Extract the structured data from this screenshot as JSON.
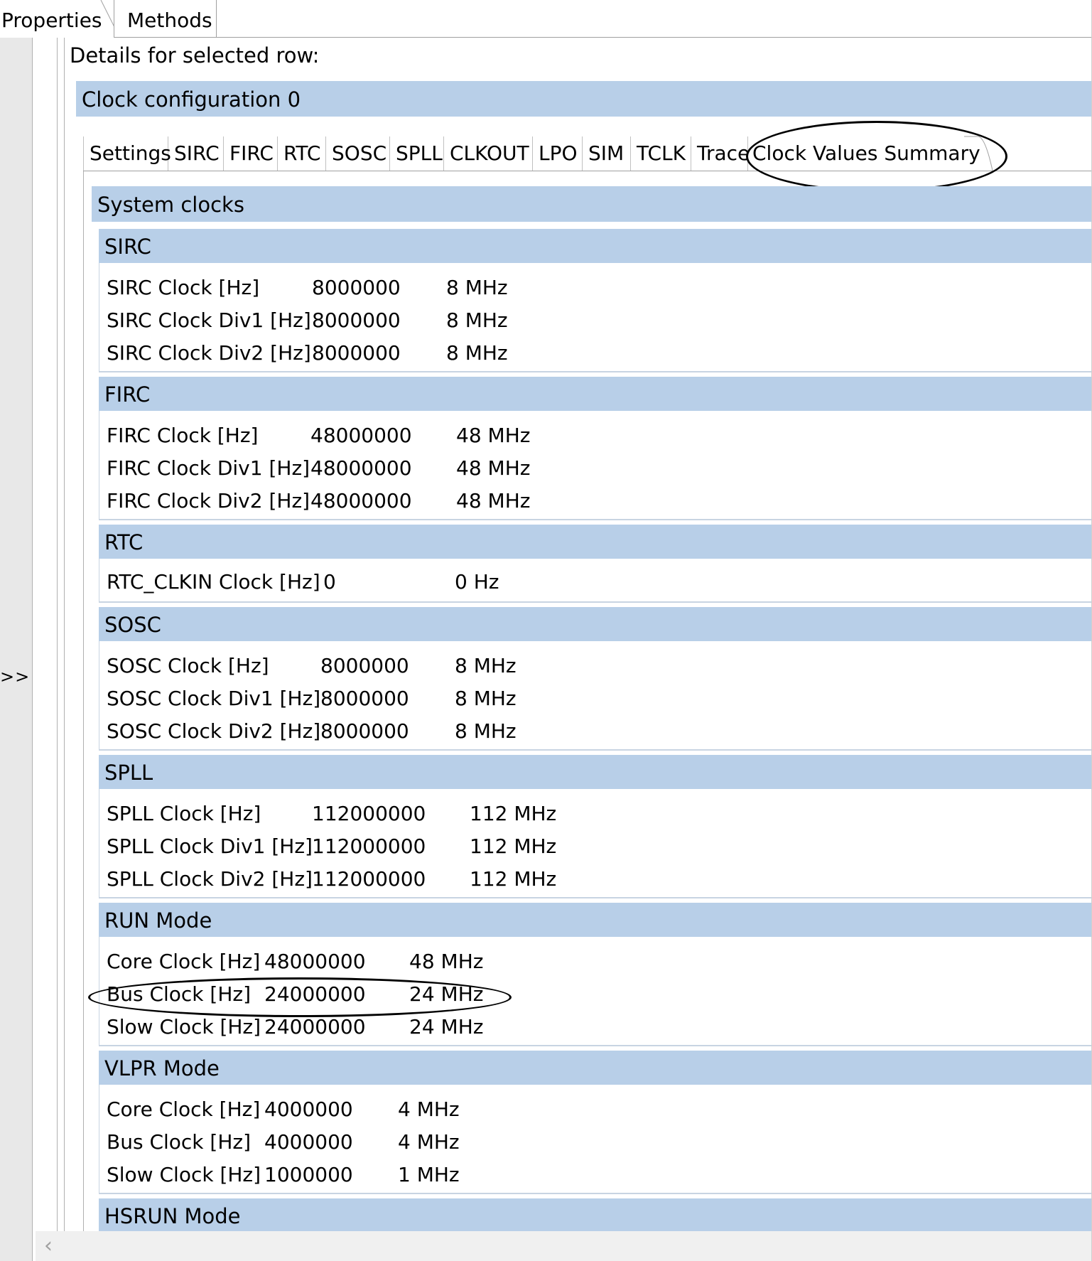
{
  "top_tabs": {
    "properties": "Properties",
    "methods": "Methods"
  },
  "gutter": {
    "expand": ">>"
  },
  "details_title": "Details for selected row:",
  "config_header": "Clock configuration 0",
  "inner_tabs": [
    "Settings",
    "SIRC",
    "FIRC",
    "RTC",
    "SOSC",
    "SPLL",
    "CLKOUT",
    "LPO",
    "SIM",
    "TCLK",
    "Trace",
    "Clock Values Summary"
  ],
  "active_tab": "Clock Values Summary",
  "system_clocks": {
    "header": "System clocks",
    "sections": [
      {
        "title": "SIRC",
        "rows": [
          [
            "SIRC Clock [Hz]",
            "8000000",
            "8 MHz"
          ],
          [
            "SIRC Clock Div1 [Hz]",
            "8000000",
            "8 MHz"
          ],
          [
            "SIRC Clock Div2 [Hz]",
            "8000000",
            "8 MHz"
          ]
        ]
      },
      {
        "title": "FIRC",
        "rows": [
          [
            "FIRC Clock [Hz]",
            "48000000",
            "48 MHz"
          ],
          [
            "FIRC Clock Div1 [Hz]",
            "48000000",
            "48 MHz"
          ],
          [
            "FIRC Clock Div2 [Hz]",
            "48000000",
            "48 MHz"
          ]
        ]
      },
      {
        "title": "RTC",
        "rows": [
          [
            "RTC_CLKIN Clock [Hz]",
            "0",
            "0 Hz"
          ]
        ]
      },
      {
        "title": "SOSC",
        "rows": [
          [
            "SOSC Clock [Hz]",
            "8000000",
            "8 MHz"
          ],
          [
            "SOSC Clock Div1 [Hz]",
            "8000000",
            "8 MHz"
          ],
          [
            "SOSC Clock Div2 [Hz]",
            "8000000",
            "8 MHz"
          ]
        ]
      },
      {
        "title": "SPLL",
        "rows": [
          [
            "SPLL Clock [Hz]",
            "112000000",
            "112 MHz"
          ],
          [
            "SPLL Clock Div1 [Hz]",
            "112000000",
            "112 MHz"
          ],
          [
            "SPLL Clock Div2 [Hz]",
            "112000000",
            "112 MHz"
          ]
        ]
      },
      {
        "title": "RUN Mode",
        "rows": [
          [
            "Core Clock [Hz]",
            "48000000",
            "48 MHz"
          ],
          [
            "Bus Clock [Hz]",
            "24000000",
            "24 MHz"
          ],
          [
            "Slow Clock [Hz]",
            "24000000",
            "24 MHz"
          ]
        ]
      },
      {
        "title": "VLPR Mode",
        "rows": [
          [
            "Core Clock [Hz]",
            "4000000",
            "4 MHz"
          ],
          [
            "Bus Clock [Hz]",
            "4000000",
            "4 MHz"
          ],
          [
            "Slow Clock [Hz]",
            "1000000",
            "1 MHz"
          ]
        ]
      },
      {
        "title": "HSRUN Mode",
        "rows": []
      }
    ]
  },
  "scrollbar": {
    "left_arrow": "‹"
  },
  "colors": {
    "section_header_bg": "#b8cfe8",
    "annotation": "#000000"
  }
}
